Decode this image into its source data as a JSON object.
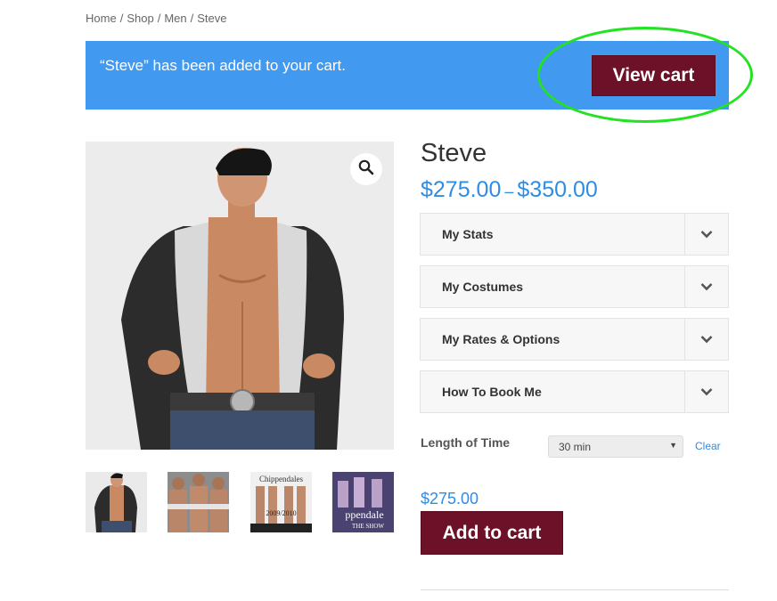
{
  "breadcrumb": {
    "items": [
      "Home",
      "Shop",
      "Men",
      "Steve"
    ],
    "separator": "/"
  },
  "notice": {
    "message": "“Steve” has been added to your cart.",
    "button_label": "View cart",
    "bg_color": "#4199f0"
  },
  "product": {
    "title": "Steve",
    "price_min": "$275.00",
    "price_dash": "–",
    "price_max": "$350.00",
    "zoom_icon": "magnifier-icon",
    "thumbnails": [
      "thumb-1",
      "thumb-2",
      "thumb-3",
      "thumb-4"
    ],
    "thumbnail_captions": [
      "Chippendales",
      "2009/2010",
      "ppendale",
      "THE SHOW"
    ]
  },
  "accordions": [
    {
      "label": "My Stats"
    },
    {
      "label": "My Costumes"
    },
    {
      "label": "My Rates & Options"
    },
    {
      "label": "How To Book Me"
    }
  ],
  "variation": {
    "label": "Length of Time",
    "selected": "30 min",
    "clear_label": "Clear",
    "price": "$275.00"
  },
  "add_to_cart": {
    "label": "Add to cart",
    "color": "#6c1128"
  },
  "colors": {
    "accent": "#2c8de5",
    "button": "#6c1128",
    "highlight": "#22e222"
  }
}
